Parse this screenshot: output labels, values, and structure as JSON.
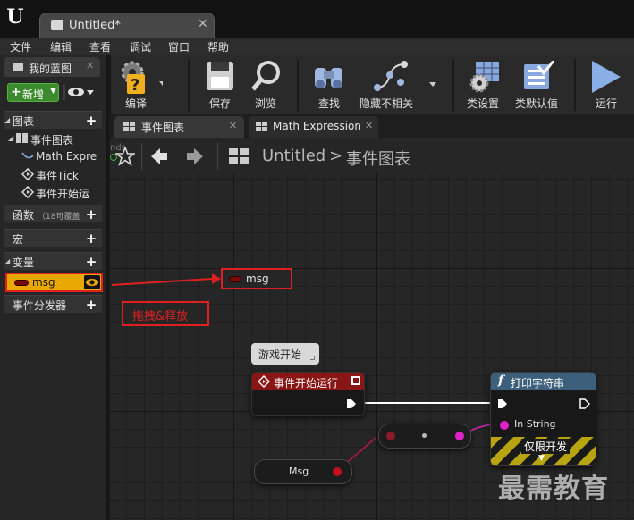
{
  "window": {
    "title": "Untitled*"
  },
  "menu": [
    "文件",
    "编辑",
    "查看",
    "调试",
    "窗口",
    "帮助"
  ],
  "left_panel": {
    "tab_label": "我的蓝图",
    "add_new_label": "新增",
    "sections": {
      "graphs": "图表",
      "event_graph": "事件图表",
      "event_graph_items": [
        "Math Expre",
        "事件Tick",
        "事件开始运"
      ],
      "functions": "函数",
      "functions_note": "（18可覆盖",
      "macros": "宏",
      "variables": "变量",
      "event_dispatchers": "事件分发器"
    },
    "variable_msg": "msg"
  },
  "toolbar": {
    "compile": "编译",
    "save": "保存",
    "browse": "浏览",
    "find": "查找",
    "hide_unrelated": "隐藏不相关",
    "class_settings": "类设置",
    "class_defaults": "类默认值",
    "run": "运行"
  },
  "graph_tabs": [
    "事件图表",
    "Math Expression"
  ],
  "graph": {
    "breadcrumb_root": "Untitled",
    "breadcrumb_sep": ">",
    "breadcrumb_current": "事件图表",
    "corner_text": "nds",
    "drag_node_label": "msg",
    "annotation": "拖拽&释放",
    "comment_bubble": "游戏开始",
    "begin_play_title": "事件开始运行",
    "print_title": "打印字符串",
    "print_in_string": "In String",
    "print_dev_only": "仅限开发",
    "getter_label": "Msg"
  },
  "watermark": "最需教育",
  "colors": {
    "accent_red": "#e02020",
    "variable_highlight": "#e8a800",
    "add_new_green": "#3c8a2e",
    "string_pin": "#e020c8"
  }
}
